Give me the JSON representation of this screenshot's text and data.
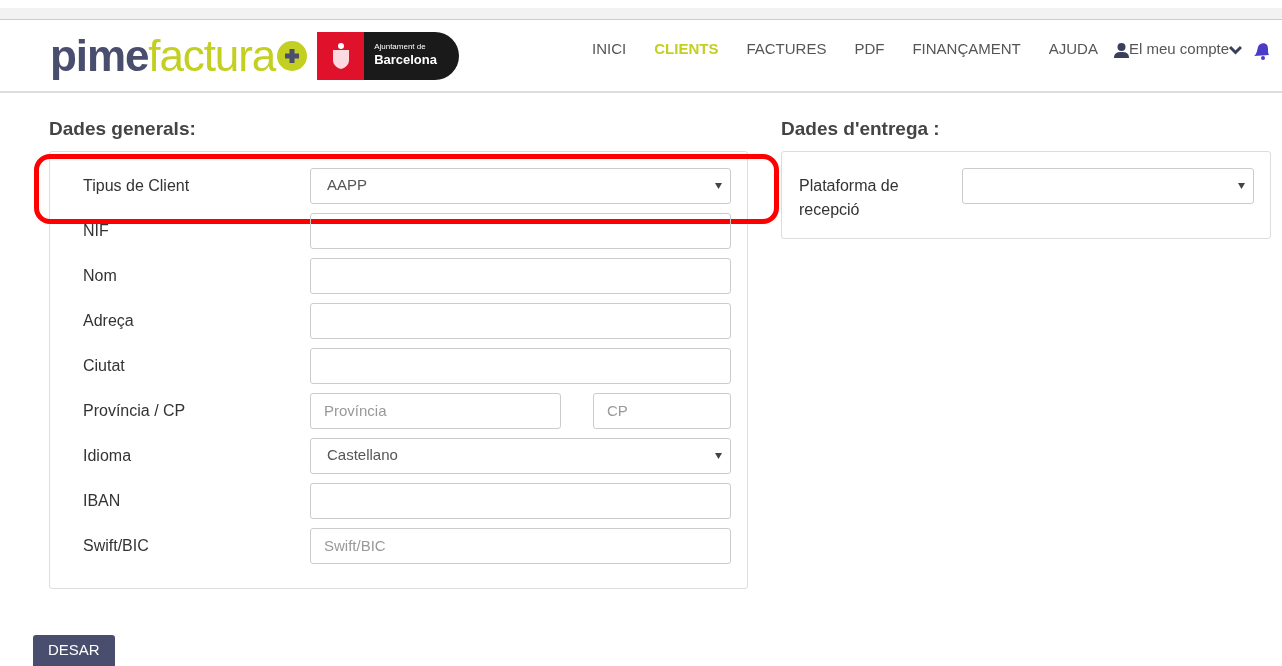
{
  "header": {
    "logo": {
      "brand_dark": "pime",
      "brand_light": "factura"
    },
    "partner": {
      "line1": "Ajuntament de",
      "line2": "Barcelona"
    },
    "nav": [
      {
        "label": "INICI",
        "selected": false
      },
      {
        "label": "CLIENTS",
        "selected": true
      },
      {
        "label": "FACTURES",
        "selected": false
      },
      {
        "label": "PDF",
        "selected": false
      },
      {
        "label": "FINANÇAMENT",
        "selected": false
      },
      {
        "label": "AJUDA",
        "selected": false
      }
    ],
    "account": "El meu compte"
  },
  "general": {
    "title": "Dades generals:",
    "rows": [
      {
        "kind": "select",
        "label": "Tipus de Client",
        "value": "AAPP",
        "highlighted": true
      },
      {
        "kind": "text",
        "label": "NIF"
      },
      {
        "kind": "text",
        "label": "Nom"
      },
      {
        "kind": "text",
        "label": "Adreça"
      },
      {
        "kind": "text",
        "label": "Ciutat"
      },
      {
        "kind": "split",
        "label": "Província / CP",
        "fields": [
          {
            "placeholder": "Província"
          },
          {
            "placeholder": "CP"
          }
        ]
      },
      {
        "kind": "select",
        "label": "Idioma",
        "value": "Castellano"
      },
      {
        "kind": "text",
        "label": "IBAN"
      },
      {
        "kind": "text",
        "label": "Swift/BIC",
        "placeholder": "Swift/BIC"
      }
    ]
  },
  "delivery": {
    "title": "Dades d'entrega :",
    "rows": [
      {
        "kind": "select",
        "label": "Plataforma de recepció"
      }
    ]
  },
  "save_button": "DESAR"
}
